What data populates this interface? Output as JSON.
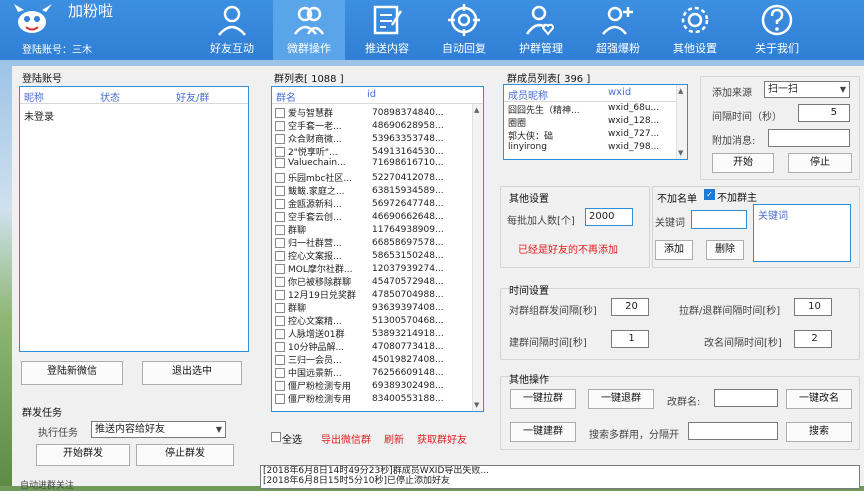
{
  "app": {
    "name": "加粉啦",
    "account_label": "登陆账号：三木"
  },
  "nav": [
    {
      "label": "好友互动",
      "icon": "user-icon"
    },
    {
      "label": "微群操作",
      "icon": "group-icon",
      "active": true
    },
    {
      "label": "推送内容",
      "icon": "edit-icon"
    },
    {
      "label": "自动回复",
      "icon": "target-icon"
    },
    {
      "label": "护群管理",
      "icon": "heart-user-icon"
    },
    {
      "label": "超强爆粉",
      "icon": "add-user-icon"
    },
    {
      "label": "其他设置",
      "icon": "gear-icon"
    },
    {
      "label": "关于我们",
      "icon": "help-icon"
    }
  ],
  "login": {
    "title": "登陆账号",
    "columns": [
      "昵称",
      "状态",
      "好友/群"
    ],
    "rows": [
      "未登录"
    ],
    "login_button": "登陆新微信",
    "logout_button": "退出选中"
  },
  "mass_task": {
    "title": "群发任务",
    "exec_label": "执行任务",
    "exec_value": "推送内容给好友",
    "start_button": "开始群发",
    "stop_button": "停止群发"
  },
  "group_list": {
    "title": "群列表[ 1088 ]",
    "columns": [
      "群名",
      "id"
    ],
    "rows": [
      {
        "name": "爱与智慧群",
        "id": "70898374840..."
      },
      {
        "name": "空手套一老...",
        "id": "48690628958..."
      },
      {
        "name": "众合财商微...",
        "id": "53963353748..."
      },
      {
        "name": "2\"悦享听\"...",
        "id": "54913164530..."
      },
      {
        "name": "Valuechain...",
        "id": "71698616710..."
      },
      {
        "name": "乐园mbc社区...",
        "id": "52270412078..."
      },
      {
        "name": "鲅鲅.家庭之...",
        "id": "63815934589..."
      },
      {
        "name": "金瓯源新科...",
        "id": "56972647748..."
      },
      {
        "name": "空手套云创...",
        "id": "46690662648..."
      },
      {
        "name": "群聊",
        "id": "11764938909..."
      },
      {
        "name": "归一社群营...",
        "id": "66858697578..."
      },
      {
        "name": "控心文案报...",
        "id": "58653150248..."
      },
      {
        "name": "MOL摩尔社群...",
        "id": "12037939274..."
      },
      {
        "name": "你已被移除群聊",
        "id": "45470572948..."
      },
      {
        "name": "12月19日兑奖群",
        "id": "47850704988..."
      },
      {
        "name": "群聊",
        "id": "93639397408..."
      },
      {
        "name": "控心文案精...",
        "id": "51300570468..."
      },
      {
        "name": "人脉增送01群",
        "id": "53893214918..."
      },
      {
        "name": "10分钟品解...",
        "id": "47080773418..."
      },
      {
        "name": "三归一会员...",
        "id": "45019827408..."
      },
      {
        "name": "中国远景新...",
        "id": "76256609148..."
      },
      {
        "name": "僵尸粉检测专用",
        "id": "69389302498..."
      },
      {
        "name": "僵尸粉检测专用",
        "id": "83400553188..."
      }
    ],
    "select_all": "全选",
    "export_link": "导出微信群",
    "refresh_link": "刷新",
    "fetch_link": "获取群好友"
  },
  "members": {
    "title": "群成员列表[ 396 ]",
    "columns": [
      "成员昵称",
      "wxid"
    ],
    "rows": [
      {
        "name": "囧囧先生（精神...",
        "wxid": "wxid_68u..."
      },
      {
        "name": "圈圈",
        "wxid": "wxid_128..."
      },
      {
        "name": "郭大侠：础",
        "wxid": "wxid_727..."
      },
      {
        "name": "linyirong",
        "wxid": "wxid_798..."
      }
    ]
  },
  "add_source": {
    "source_label": "添加来源",
    "source_value": "扫一扫",
    "interval_label": "间隔时间（秒）",
    "interval_value": "5",
    "extra_label": "附加消息:",
    "start_button": "开始",
    "stop_button": "停止"
  },
  "other_settings": {
    "title": "其他设置",
    "batch_label": "每批加人数[个]",
    "batch_value": "2000",
    "warning": "已经是好友的不再添加"
  },
  "no_add_list": {
    "title": "不加名单",
    "no_add_group_label": "不加群主",
    "keyword_label": "关键词",
    "keyword_header": "关键词",
    "add_button": "添加",
    "delete_button": "删除"
  },
  "time_settings": {
    "title": "时间设置",
    "pull_interval_label": "对群组群发间隔[秒]",
    "pull_interval_value": "20",
    "kick_interval_label": "拉群/退群间隔时间[秒]",
    "kick_interval_value": "10",
    "build_interval_label": "建群间隔时间[秒]",
    "build_interval_value": "1",
    "rename_interval_label": "改名间隔时间[秒]",
    "rename_interval_value": "2"
  },
  "other_ops": {
    "title": "其他操作",
    "pull_button": "一键拉群",
    "quit_button": "一键退群",
    "rename_label": "改群名:",
    "rename_button": "一键改名",
    "build_button": "一键建群",
    "search_label": "搜索多群用，分隔开",
    "search_button": "搜索"
  },
  "log": {
    "lines": [
      "[2018年6月8日14时49分23秒]群成员WXID导出失败...",
      "[2018年6月8日15时5分10秒]已停止添加好友"
    ]
  },
  "footer": {
    "partial_text": "自动进群关注"
  }
}
